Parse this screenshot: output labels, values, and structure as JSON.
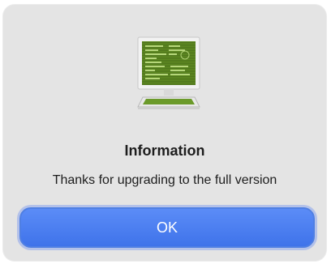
{
  "dialog": {
    "title": "Information",
    "message": "Thanks for upgrading to the full version",
    "ok_label": "OK",
    "icon": "computer-monitor-icon"
  },
  "colors": {
    "dialog_background": "#e4e4e4",
    "button_blue": "#4a7ff0",
    "text": "#1d1d1d",
    "screen_green": "#6b9a2a"
  }
}
